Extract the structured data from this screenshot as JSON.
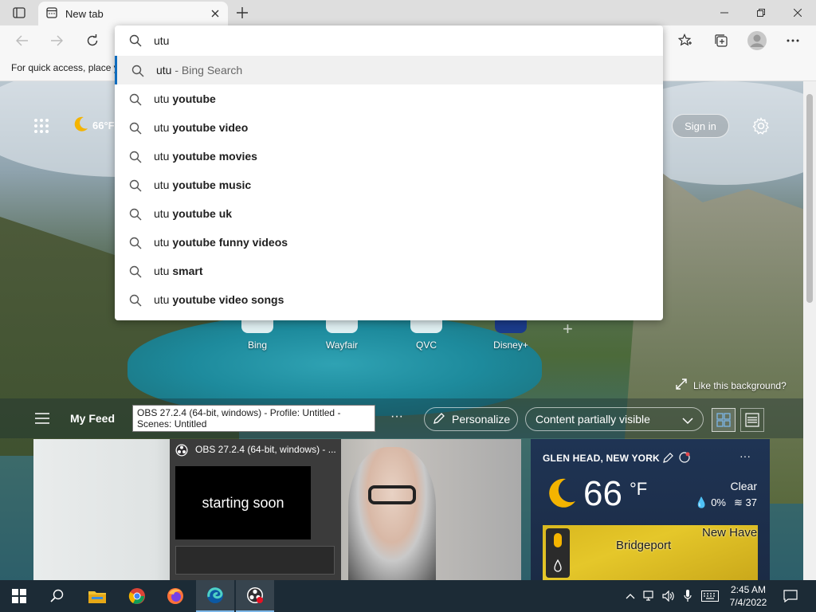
{
  "browser": {
    "tab_title": "New tab",
    "favbar_text": "For quick access, place y"
  },
  "omnibox": {
    "query": "utu",
    "suggestions": [
      {
        "prefix": "utu",
        "bold": "",
        "suffix": " - Bing Search",
        "selected": true
      },
      {
        "prefix": "utu ",
        "bold": "youtube",
        "suffix": ""
      },
      {
        "prefix": "utu ",
        "bold": "youtube video",
        "suffix": ""
      },
      {
        "prefix": "utu ",
        "bold": "youtube movies",
        "suffix": ""
      },
      {
        "prefix": "utu ",
        "bold": "youtube music",
        "suffix": ""
      },
      {
        "prefix": "utu ",
        "bold": "youtube uk",
        "suffix": ""
      },
      {
        "prefix": "utu ",
        "bold": "youtube funny videos",
        "suffix": ""
      },
      {
        "prefix": "utu ",
        "bold": "smart",
        "suffix": ""
      },
      {
        "prefix": "utu ",
        "bold": "youtube video songs",
        "suffix": ""
      }
    ]
  },
  "newtab": {
    "weather_temp": "66°F",
    "signin_label": "Sign in",
    "quicklinks": [
      "Bing",
      "Wayfair",
      "QVC",
      "Disney+"
    ],
    "like_background": "Like this background?",
    "my_feed": "My Feed",
    "tooltip": "OBS 27.2.4 (64-bit, windows) - Profile: Untitled - Scenes: Untitled",
    "personalize": "Personalize",
    "content_visibility": "Content partially visible"
  },
  "news_card": {
    "obs_window_title": "OBS 27.2.4 (64-bit, windows) - ...",
    "obs_preview_text": "starting soon"
  },
  "weather_card": {
    "location": "GLEN HEAD, NEW YORK",
    "temp": "66",
    "unit": "°F",
    "condition": "Clear",
    "precip": "0%",
    "aqi": "37",
    "map_label_1": "Bridgeport",
    "map_label_2": "New Have"
  },
  "taskbar": {
    "time": "2:45 AM",
    "date": "7/4/2022"
  },
  "colors": {
    "accent": "#0f6cbd",
    "taskbar": "#1c2b36",
    "weather_card": "#1f3454"
  }
}
